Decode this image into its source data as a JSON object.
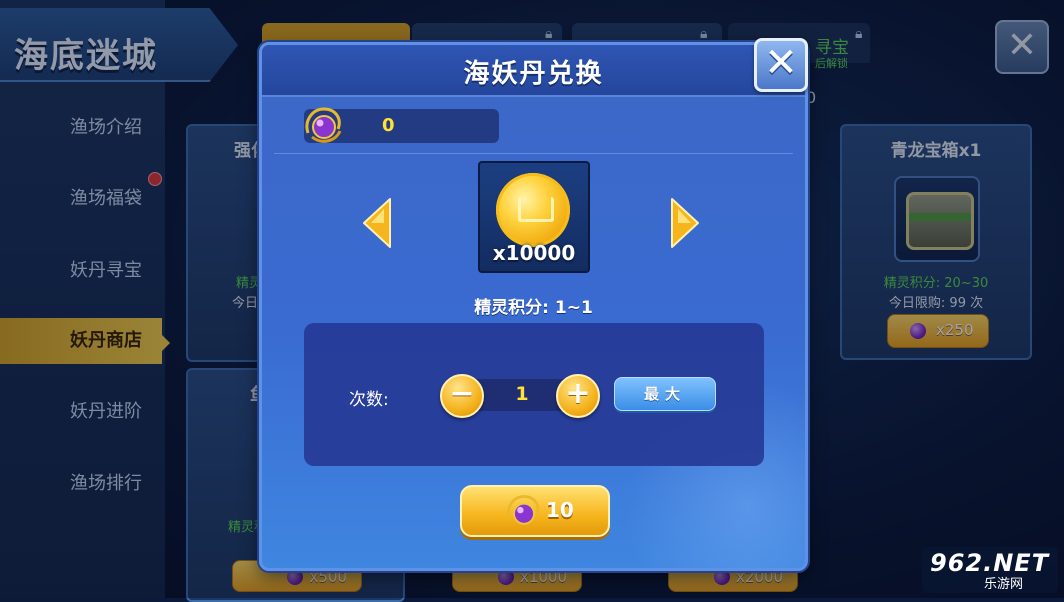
{
  "background": {
    "title": "海底迷城",
    "sidebar": {
      "items": [
        {
          "label": "渔场介绍",
          "active": false
        },
        {
          "label": "渔场福袋",
          "active": false
        },
        {
          "label": "妖丹寻宝",
          "active": false
        },
        {
          "label": "妖丹商店",
          "active": true
        },
        {
          "label": "妖丹进阶",
          "active": false
        },
        {
          "label": "渔场排行",
          "active": false
        }
      ]
    },
    "tab4": {
      "label": "寻宝",
      "sub": "后解锁",
      "value": "0"
    },
    "cards": {
      "qinglong": {
        "title": "青龙宝箱x1",
        "score": "精灵积分: 20~30",
        "limit": "今日限购: 99 次",
        "price": "x250"
      },
      "left_a": {
        "title": "强化",
        "score": "精灵",
        "limit": "今日"
      },
      "left_b": {
        "title": "鱼",
        "score": "精灵积"
      }
    },
    "prices": [
      "x500",
      "x1000",
      "x2000"
    ],
    "close_icon": "close-icon",
    "watermark": {
      "main": "962.NET",
      "sub": "乐游网"
    }
  },
  "modal": {
    "title": "海妖丹兑换",
    "balance": "0",
    "item_qty": "x10000",
    "score_label": "精灵积分: 1~1",
    "count_label": "次数:",
    "count_value": "1",
    "minus_label": "−",
    "plus_label": "+",
    "max_label": "最大",
    "exchange_cost": "10",
    "close_label": "✕"
  },
  "colors": {
    "accent_gold": "#f6b51d",
    "modal_blue": "#3a6bd1",
    "value_yellow": "#ffe233",
    "green_text": "#59d94f"
  }
}
